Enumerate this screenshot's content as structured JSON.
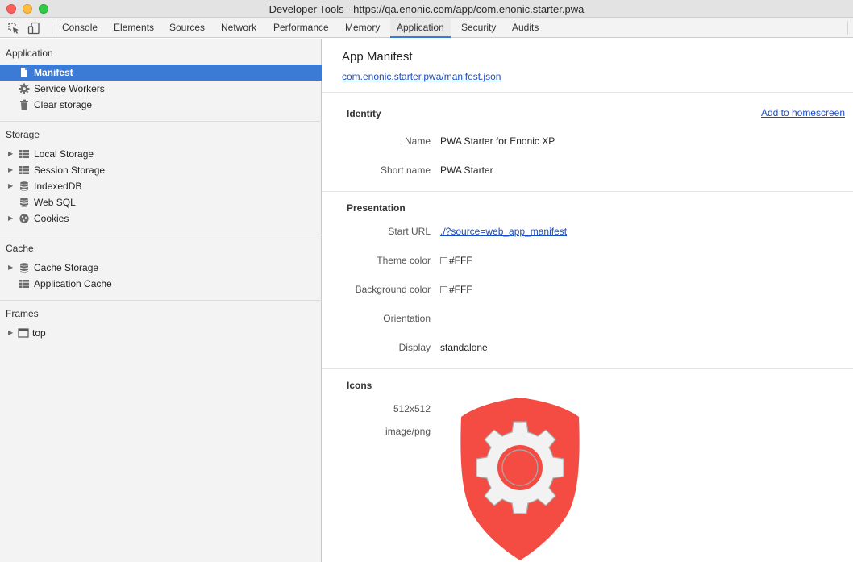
{
  "window": {
    "title": "Developer Tools - https://qa.enonic.com/app/com.enonic.starter.pwa"
  },
  "toolbar": {
    "tabs": [
      {
        "label": "Console"
      },
      {
        "label": "Elements"
      },
      {
        "label": "Sources"
      },
      {
        "label": "Network"
      },
      {
        "label": "Performance"
      },
      {
        "label": "Memory"
      },
      {
        "label": "Application"
      },
      {
        "label": "Security"
      },
      {
        "label": "Audits"
      }
    ],
    "active_tab": "Application"
  },
  "sidebar": {
    "sections": [
      {
        "title": "Application",
        "items": [
          {
            "label": "Manifest",
            "icon": "document-icon",
            "selected": true
          },
          {
            "label": "Service Workers",
            "icon": "gear-icon"
          },
          {
            "label": "Clear storage",
            "icon": "trash-icon"
          }
        ]
      },
      {
        "title": "Storage",
        "items": [
          {
            "label": "Local Storage",
            "icon": "grid-icon",
            "expandable": true
          },
          {
            "label": "Session Storage",
            "icon": "grid-icon",
            "expandable": true
          },
          {
            "label": "IndexedDB",
            "icon": "database-icon",
            "expandable": true
          },
          {
            "label": "Web SQL",
            "icon": "database-icon"
          },
          {
            "label": "Cookies",
            "icon": "cookie-icon",
            "expandable": true
          }
        ]
      },
      {
        "title": "Cache",
        "items": [
          {
            "label": "Cache Storage",
            "icon": "database-icon",
            "expandable": true
          },
          {
            "label": "Application Cache",
            "icon": "grid-icon"
          }
        ]
      },
      {
        "title": "Frames",
        "items": [
          {
            "label": "top",
            "icon": "frame-icon",
            "expandable": true
          }
        ]
      }
    ]
  },
  "main": {
    "title": "App Manifest",
    "manifest_link": "com.enonic.starter.pwa/manifest.json",
    "identity": {
      "heading": "Identity",
      "add_to_homescreen": "Add to homescreen",
      "name_label": "Name",
      "name_value": "PWA Starter for Enonic XP",
      "short_name_label": "Short name",
      "short_name_value": "PWA Starter"
    },
    "presentation": {
      "heading": "Presentation",
      "start_url_label": "Start URL",
      "start_url_value": "./?source=web_app_manifest",
      "theme_color_label": "Theme color",
      "theme_color_value": "#FFF",
      "background_color_label": "Background color",
      "background_color_value": "#FFF",
      "orientation_label": "Orientation",
      "orientation_value": "",
      "display_label": "Display",
      "display_value": "standalone"
    },
    "icons": {
      "heading": "Icons",
      "size": "512x512",
      "type": "image/png",
      "icon_color": "#f44c42"
    }
  },
  "colors": {
    "selection": "#3b7bd6",
    "link": "#1a4ec9",
    "active_tab_underline": "#3879d9"
  }
}
